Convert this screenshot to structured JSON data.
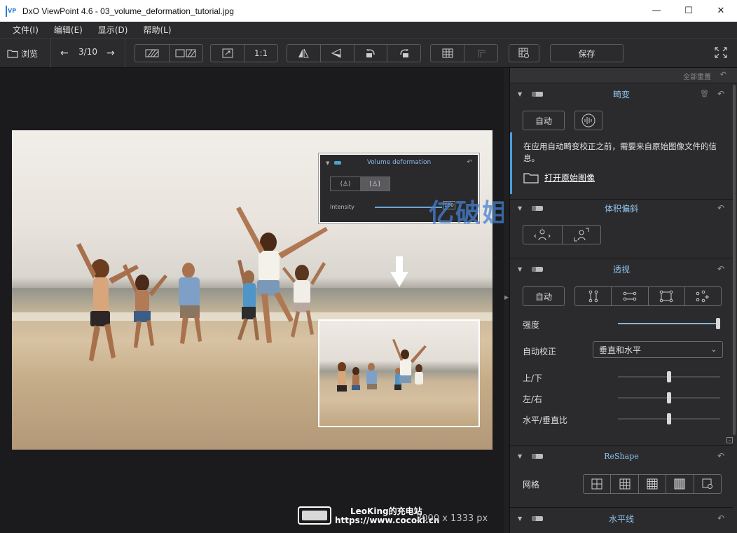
{
  "window": {
    "app_icon": "VP",
    "title": "DxO ViewPoint 4.6 - 03_volume_deformation_tutorial.jpg",
    "minimize": "—",
    "maximize": "☐",
    "close": "✕"
  },
  "menu": [
    "文件(I)",
    "编辑(E)",
    "显示(D)",
    "帮助(L)"
  ],
  "toolbar": {
    "browse_label": "浏览",
    "counter": "3/10",
    "one_to_one": "1:1",
    "save_label": "保存"
  },
  "canvas": {
    "vd_panel": {
      "title": "Volume deformation",
      "intensity_label": "Intensity",
      "intensity_value": "150",
      "intensity_fill": 0.8
    },
    "watermark_cn": "亿破姐网站",
    "dims": "2000 x 1333 px",
    "watermark_line1": "LeoKing的充电站",
    "watermark_line2": "https://www.cocokl.cn"
  },
  "panel": {
    "reset_all": "全部重置",
    "sections": {
      "distortion": {
        "title": "畸变",
        "auto_label": "自动",
        "info_text": "在应用自动畸变校正之前，需要来自原始图像文件的信息。",
        "open_original": "打开原始图像"
      },
      "volume": {
        "title": "体积偏斜"
      },
      "perspective": {
        "title": "透视",
        "auto_label": "自动",
        "intensity_label": "强度",
        "intensity_value": 1.0,
        "auto_correct_label": "自动校正",
        "auto_correct_value": "垂直和水平",
        "updown_label": "上/下",
        "updown_value": 0.5,
        "leftright_label": "左/右",
        "leftright_value": 0.5,
        "ratio_label": "水平/垂直比",
        "ratio_value": 0.5
      },
      "reshape": {
        "title": "ReShape",
        "grid_label": "网格"
      },
      "horizon": {
        "title": "水平线"
      }
    }
  },
  "colors": {
    "accent": "#8fc3ec",
    "info_bar": "#4a9fdc",
    "bg": "#1b1b1d",
    "panel": "#2b2b2d"
  }
}
